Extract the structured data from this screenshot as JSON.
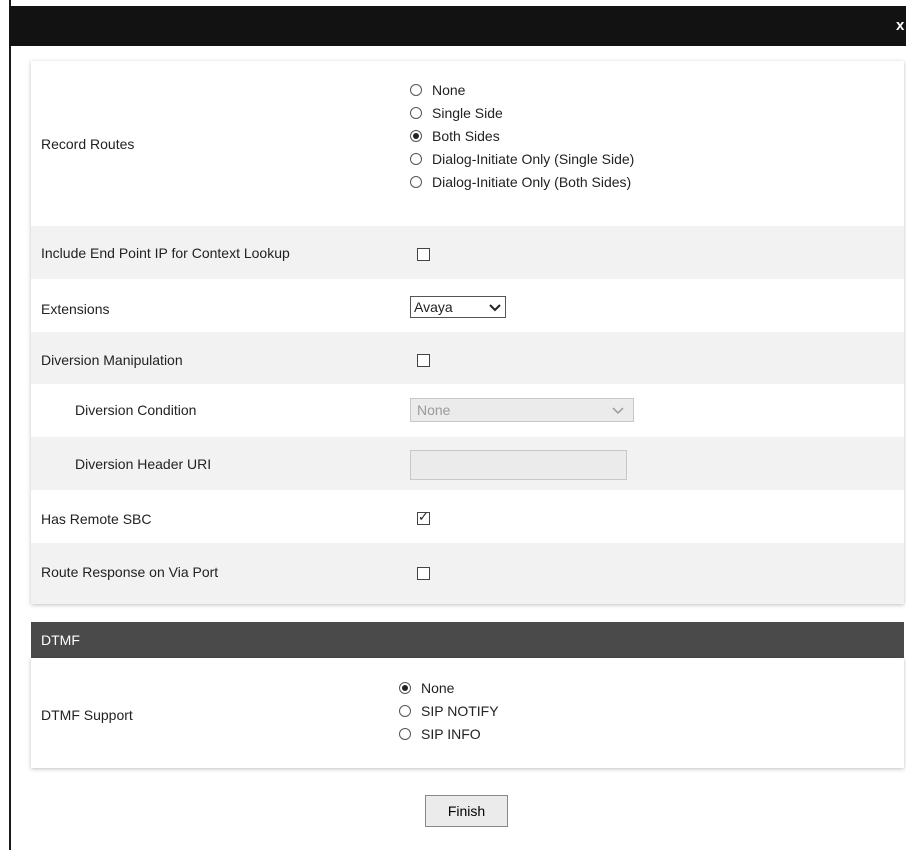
{
  "window": {
    "close_label": "x"
  },
  "fields": {
    "record_routes": {
      "label": "Record Routes",
      "options": [
        "None",
        "Single Side",
        "Both Sides",
        "Dialog-Initiate Only (Single Side)",
        "Dialog-Initiate Only (Both Sides)"
      ],
      "selected": "Both Sides"
    },
    "include_endpoint_ip": {
      "label": "Include End Point IP for Context Lookup",
      "checked": false
    },
    "extensions": {
      "label": "Extensions",
      "value": "Avaya"
    },
    "diversion_manipulation": {
      "label": "Diversion Manipulation",
      "checked": false
    },
    "diversion_condition": {
      "label": "Diversion Condition",
      "value": "None",
      "disabled": true
    },
    "diversion_header_uri": {
      "label": "Diversion Header URI",
      "value": "",
      "disabled": true
    },
    "has_remote_sbc": {
      "label": "Has Remote SBC",
      "checked": true
    },
    "route_response_via_port": {
      "label": "Route Response on Via Port",
      "checked": false
    }
  },
  "dtmf": {
    "section_title": "DTMF",
    "support": {
      "label": "DTMF Support",
      "options": [
        "None",
        "SIP NOTIFY",
        "SIP INFO"
      ],
      "selected": "None"
    }
  },
  "actions": {
    "finish_label": "Finish"
  }
}
